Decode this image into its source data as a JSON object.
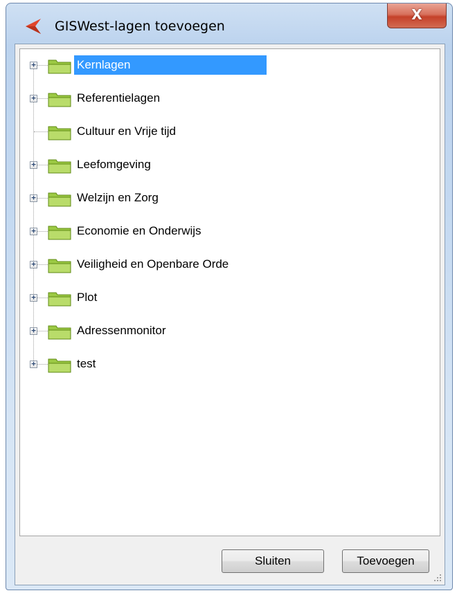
{
  "window": {
    "title": "GISWest-lagen toevoegen",
    "close_label": "X",
    "app_icon": "giswest-logo-icon"
  },
  "tree": {
    "items": [
      {
        "label": "Kernlagen",
        "expandable": true,
        "selected": true
      },
      {
        "label": "Referentielagen",
        "expandable": true,
        "selected": false
      },
      {
        "label": "Cultuur en Vrije tijd",
        "expandable": false,
        "selected": false
      },
      {
        "label": "Leefomgeving",
        "expandable": true,
        "selected": false
      },
      {
        "label": "Welzijn en Zorg",
        "expandable": true,
        "selected": false
      },
      {
        "label": "Economie en Onderwijs",
        "expandable": true,
        "selected": false
      },
      {
        "label": "Veiligheid en Openbare Orde",
        "expandable": true,
        "selected": false
      },
      {
        "label": "Plot",
        "expandable": true,
        "selected": false
      },
      {
        "label": "Adressenmonitor",
        "expandable": true,
        "selected": false
      },
      {
        "label": "test",
        "expandable": true,
        "selected": false
      }
    ],
    "expander_glyph": "+",
    "folder_icon": "folder-icon"
  },
  "footer": {
    "close_button": "Sluiten",
    "add_button": "Toevoegen"
  },
  "colors": {
    "selection": "#3399ff",
    "folder_green": "#8fbf2a",
    "close_red": "#c5412a"
  }
}
